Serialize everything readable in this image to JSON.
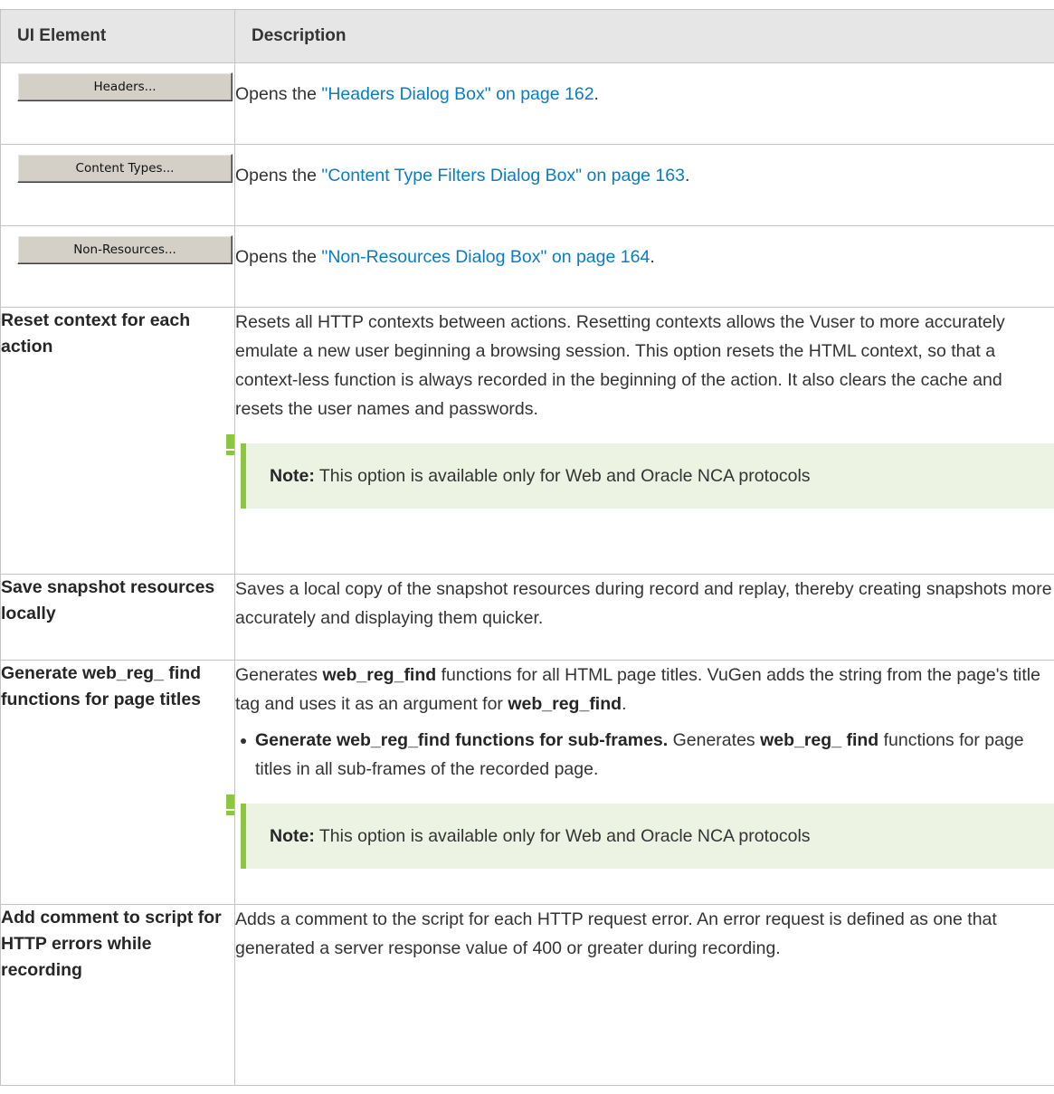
{
  "table": {
    "headers": [
      "UI Element",
      "Description"
    ],
    "rows": {
      "headers": {
        "button_label": "Headers...",
        "desc_prefix": "Opens the ",
        "link": "\"Headers Dialog Box\" on page 162",
        "desc_suffix": "."
      },
      "content_types": {
        "button_label": "Content Types...",
        "desc_prefix": "Opens the ",
        "link": "\"Content Type Filters Dialog Box\" on page 163",
        "desc_suffix": "."
      },
      "non_resources": {
        "button_label": "Non-Resources...",
        "desc_prefix": "Opens the ",
        "link": "\"Non-Resources Dialog Box\" on page 164",
        "desc_suffix": "."
      },
      "reset_context": {
        "element": "Reset context for each action",
        "description": "Resets all HTTP contexts between actions. Resetting contexts allows the Vuser to more accurately emulate a new user beginning a browsing session. This option resets the HTML context, so that a context-less function is always recorded in the beginning of the action. It also clears the cache and resets the user names and passwords.",
        "note_label": "Note:",
        "note_text": " This option is available only for Web and Oracle NCA protocols"
      },
      "save_snapshot": {
        "element": "Save snapshot resources locally",
        "description": "Saves a local copy of the snapshot resources during record and replay, thereby creating snapshots more accurately and displaying them quicker."
      },
      "generate_reg_find": {
        "element": "Generate web_reg_ find functions for page titles",
        "desc_1": "Generates ",
        "desc_fn": "web_reg_find",
        "desc_2": " functions for all HTML page titles. VuGen adds the string from the page's title tag and uses it as an argument for ",
        "desc_fn2": "web_reg_find",
        "desc_3": ".",
        "option_title": "Generate web_reg_find functions for sub-frames.",
        "option_1": " Generates ",
        "option_fn": "web_reg_ find",
        "option_2": " functions for page titles in all sub-frames of the recorded page.",
        "note_label": "Note:",
        "note_text": " This option is available only for Web and Oracle NCA protocols"
      },
      "add_comment": {
        "element": "Add comment to script for HTTP errors while recording",
        "description": "Adds a comment to the script for each HTTP request error. An error request is defined as one that generated a server response value of 400 or greater during recording."
      }
    }
  },
  "colors": {
    "link": "#0b7dbf",
    "note_accent": "#8dc63f",
    "note_bg": "#ecf3e3",
    "header_bg": "#e6e6e6"
  }
}
